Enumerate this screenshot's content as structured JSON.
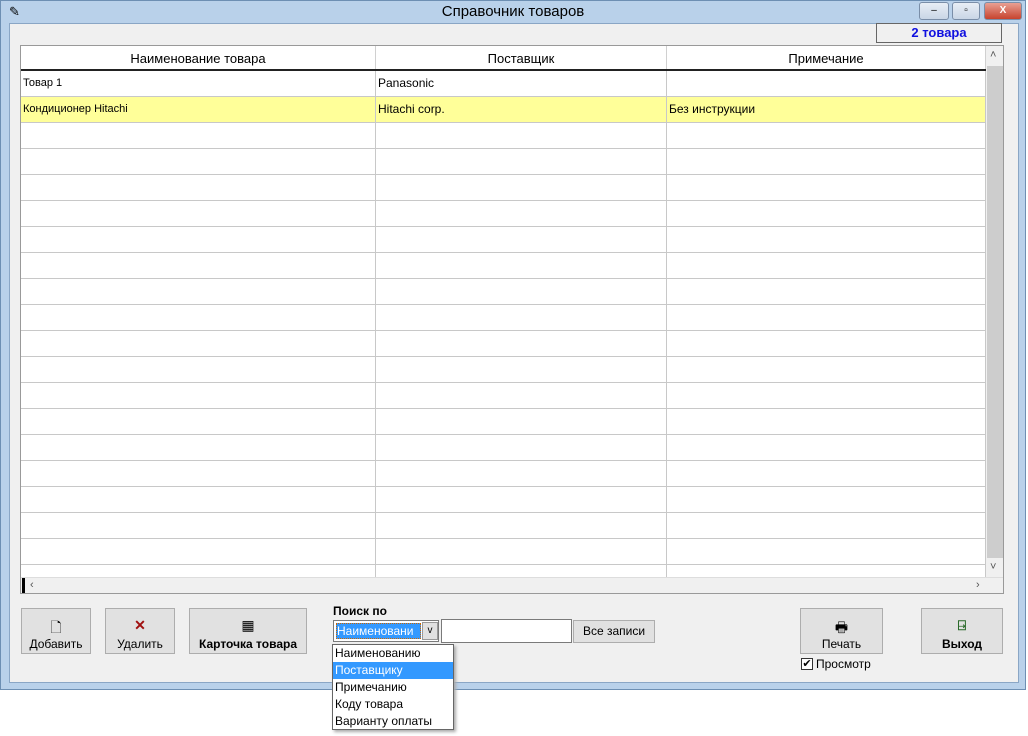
{
  "window": {
    "title": "Справочник товаров",
    "minimize": "‒",
    "maximize": "▫",
    "close": "X"
  },
  "count_badge": "2 товара",
  "grid": {
    "columns": [
      "Наименование товара",
      "Поставщик",
      "Примечание"
    ],
    "rows": [
      {
        "name": "Товар 1",
        "supplier": "Panasonic",
        "note": ""
      },
      {
        "name": "Кондиционер Hitachi",
        "supplier": "Hitachi corp.",
        "note": "Без инструкции"
      }
    ]
  },
  "toolbar": {
    "add": "Добавить",
    "delete": "Удалить",
    "card": "Карточка товара",
    "print": "Печать",
    "exit": "Выход",
    "preview": "Просмотр"
  },
  "search": {
    "label": "Поиск по",
    "selected": "Наименовани",
    "value": "",
    "all_records": "Все записи",
    "options": [
      "Наименованию",
      "Поставщику",
      "Примечанию",
      "Коду товара",
      "Варианту оплаты"
    ],
    "highlighted": 1
  },
  "colors": {
    "selected_row": "#ffff99",
    "highlight": "#3399ff",
    "count_text": "#1010e0"
  }
}
